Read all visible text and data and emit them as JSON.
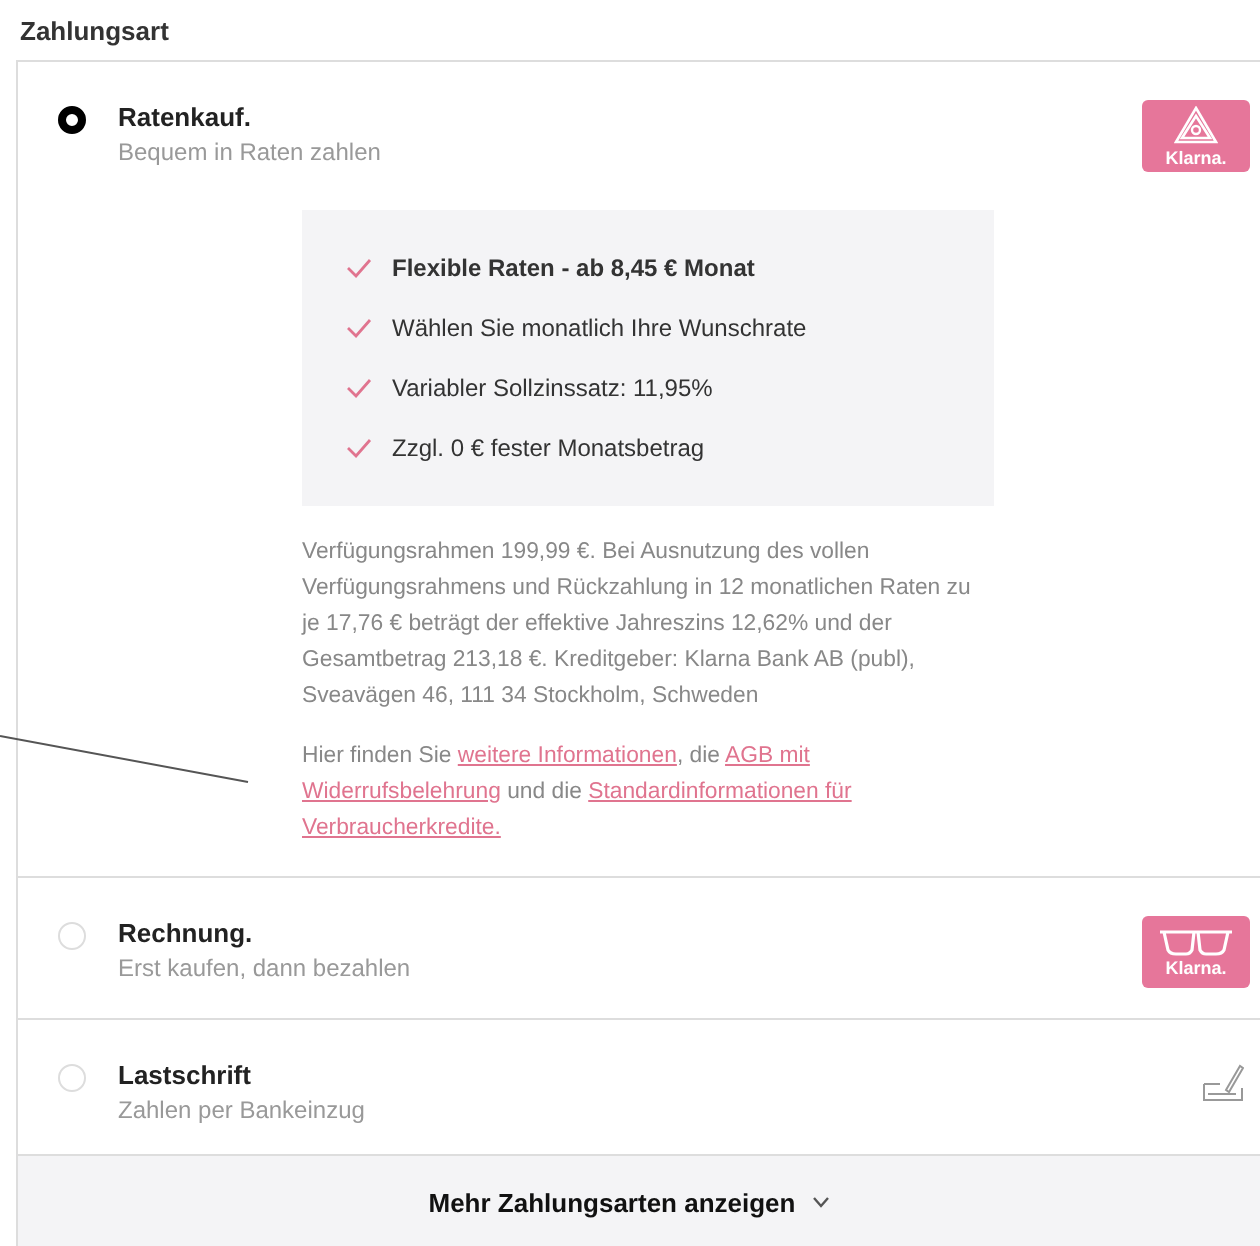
{
  "section_title": "Zahlungsart",
  "options": [
    {
      "title": "Ratenkauf.",
      "subtitle": "Bequem in Raten zahlen",
      "selected": true,
      "badge": {
        "kind": "klarna-slice",
        "label": "Klarna."
      },
      "features": [
        {
          "text": "Flexible Raten - ab 8,45 € Monat",
          "bold": true
        },
        {
          "text": "Wählen Sie monatlich Ihre Wunschrate",
          "bold": false
        },
        {
          "text": "Variabler Sollzinssatz: 11,95%",
          "bold": false
        },
        {
          "text": "Zzgl. 0 € fester Monatsbetrag",
          "bold": false
        }
      ],
      "legal": "Verfügungsrahmen 199,99 €. Bei Ausnutzung des vollen Verfügungsrahmens und Rückzahlung in 12 monatlichen Raten zu je 17,76 € beträgt der effektive Jahreszins 12,62% und der Gesamtbetrag 213,18 €. Kreditgeber: Klarna Bank AB (publ), Sveavägen 46, 111 34 Stockholm, Schweden",
      "info": [
        {
          "text": "Hier finden Sie ",
          "link": false
        },
        {
          "text": "weitere Informationen",
          "link": true
        },
        {
          "text": ", die ",
          "link": false
        },
        {
          "text": "AGB mit",
          "link": true
        },
        {
          "text": "Widerrufsbelehrung",
          "link": true
        },
        {
          "text": " und die ",
          "link": false
        },
        {
          "text": "Standardinformationen für",
          "link": true
        },
        {
          "text": "Verbraucherkredite.",
          "link": true
        }
      ]
    },
    {
      "title": "Rechnung.",
      "subtitle": "Erst kaufen, dann bezahlen",
      "selected": false,
      "badge": {
        "kind": "klarna-glasses",
        "label": "Klarna."
      }
    },
    {
      "title": "Lastschrift",
      "subtitle": "Zahlen per Bankeinzug",
      "selected": false,
      "badge": {
        "kind": "signature"
      }
    }
  ],
  "more_button": "Mehr Zahlungsarten anzeigen"
}
